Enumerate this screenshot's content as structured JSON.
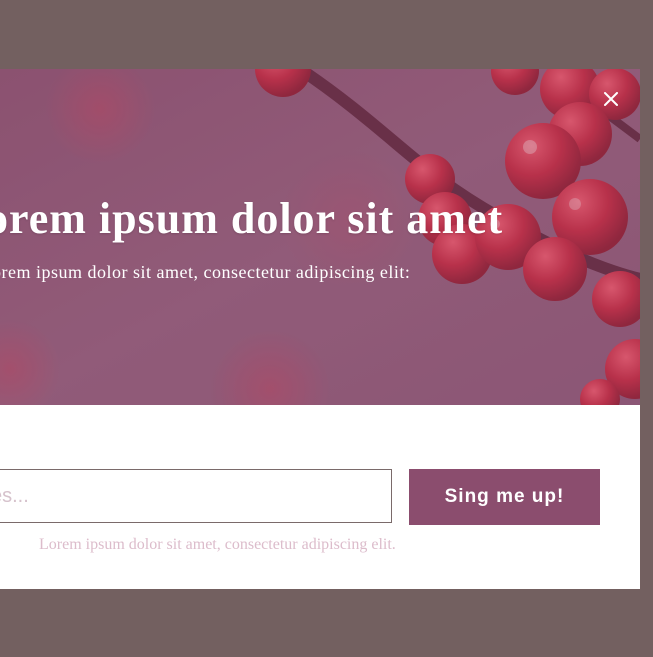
{
  "modal": {
    "title": "orem ipsum dolor sit amet",
    "subtitle": "orem ipsum dolor sit amet, consectetur adipiscing elit:",
    "close_label": "×"
  },
  "form": {
    "email_placeholder": "es...",
    "submit_label": "Sing me up!",
    "disclaimer": "Lorem ipsum dolor sit amet, consectetur adipiscing elit."
  },
  "colors": {
    "backdrop": "#736060",
    "hero_tint": "#8e5a76",
    "button": "#8b4d6e",
    "berry": "#c8283c",
    "disclaimer_text": "#dcbccb"
  },
  "icons": {
    "close": "close-icon"
  }
}
